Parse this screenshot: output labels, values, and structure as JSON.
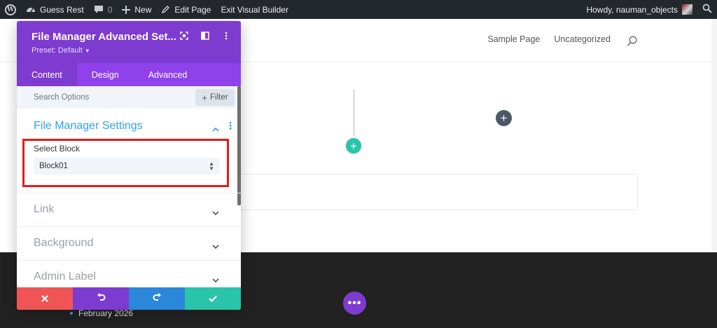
{
  "adminbar": {
    "site_name": "Guess Rest",
    "comments_count": "0",
    "new_label": "New",
    "edit_label": "Edit Page",
    "exit_label": "Exit Visual Builder",
    "greeting": "Howdy, nauman_objects"
  },
  "site": {
    "nav": [
      "Sample Page",
      "Uncategorized"
    ]
  },
  "modal": {
    "title": "File Manager Advanced Set...",
    "preset": "Preset: Default",
    "tabs": [
      "Content",
      "Design",
      "Advanced"
    ],
    "search_placeholder": "Search Options",
    "filter_label": "Filter",
    "section_title": "File Manager Settings",
    "field_label": "Select Block",
    "select_value": "Block01",
    "collapsed_sections": [
      "Link",
      "Background",
      "Admin Label"
    ]
  },
  "footer": {
    "archive_item": "February 2026"
  },
  "colors": {
    "purple": "#7e3bd0",
    "blue": "#2b87da",
    "green": "#29c4a9",
    "red": "#ef5555",
    "highlight": "#e01e1e"
  },
  "icons": {
    "head": [
      "target-icon",
      "split-view-icon",
      "kebab-menu-icon"
    ],
    "actions": [
      "close-icon",
      "undo-icon",
      "redo-icon",
      "check-icon"
    ]
  }
}
